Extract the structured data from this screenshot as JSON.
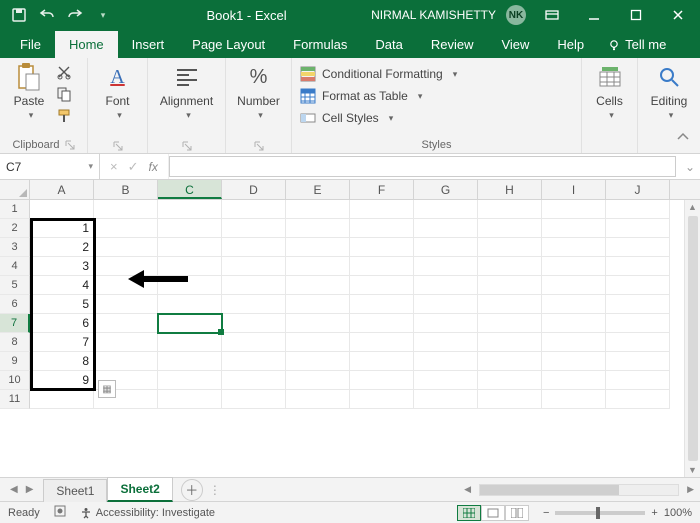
{
  "titlebar": {
    "doc_title": "Book1 - Excel",
    "user_name": "NIRMAL KAMISHETTY",
    "user_initials": "NK"
  },
  "tabs": {
    "file": "File",
    "home": "Home",
    "insert": "Insert",
    "page_layout": "Page Layout",
    "formulas": "Formulas",
    "data": "Data",
    "review": "Review",
    "view": "View",
    "help": "Help",
    "tell_me": "Tell me"
  },
  "ribbon": {
    "clipboard": {
      "label": "Clipboard",
      "paste": "Paste"
    },
    "font": {
      "label": "Font",
      "btn": "Font"
    },
    "alignment": {
      "label": "",
      "btn": "Alignment"
    },
    "number": {
      "label": "",
      "btn": "Number"
    },
    "styles": {
      "label": "Styles",
      "cond": "Conditional Formatting",
      "table": "Format as Table",
      "cellstyles": "Cell Styles"
    },
    "cells": {
      "btn": "Cells"
    },
    "editing": {
      "btn": "Editing"
    }
  },
  "formula_bar": {
    "namebox": "C7",
    "formula": ""
  },
  "grid": {
    "columns": [
      "A",
      "B",
      "C",
      "D",
      "E",
      "F",
      "G",
      "H",
      "I",
      "J"
    ],
    "row_count": 11,
    "active_cell": "C7",
    "active_row": 7,
    "active_col": "C",
    "data_colA": [
      "",
      "1",
      "2",
      "3",
      "4",
      "5",
      "6",
      "7",
      "8",
      "9",
      ""
    ]
  },
  "sheets": {
    "sheet1": "Sheet1",
    "sheet2": "Sheet2"
  },
  "status": {
    "ready": "Ready",
    "accessibility": "Accessibility: Investigate",
    "zoom": "100%"
  }
}
